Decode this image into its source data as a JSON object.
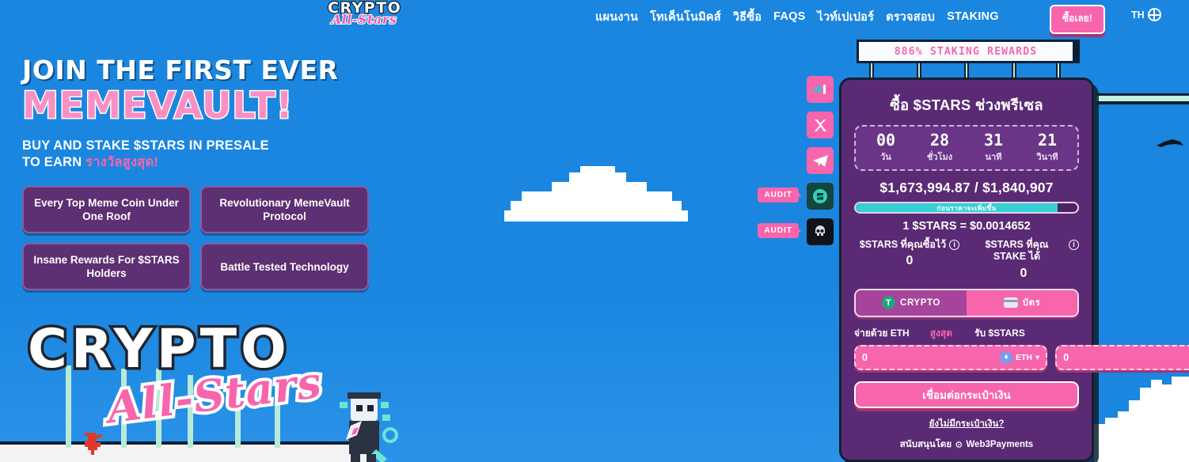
{
  "nav": {
    "logo_line1": "CRYPTO",
    "logo_line2": "All-Stars",
    "links": [
      {
        "label": "แผนงาน",
        "name": "roadmap"
      },
      {
        "label": "โทเค็นโนมิคส์",
        "name": "tokenomics"
      },
      {
        "label": "วิธีซื้อ",
        "name": "how-to-buy"
      },
      {
        "label": "FAQS",
        "name": "faqs"
      },
      {
        "label": "ไวท์เปเปอร์",
        "name": "whitepaper"
      },
      {
        "label": "ตรวจสอบ",
        "name": "audit"
      },
      {
        "label": "STAKING",
        "name": "staking"
      }
    ],
    "buy_label": "ซื้อเลย!",
    "lang_label": "TH",
    "lang_icon": "globe-icon"
  },
  "hero": {
    "line1": "JOIN THE FIRST EVER",
    "line2": "MEMEVAULT!",
    "sub_line1": "BUY AND STAKE $STARS IN PRESALE",
    "sub_line2_prefix": "TO EARN ",
    "sub_line2_highlight": "รางวัลสูงสุด!",
    "features": [
      "Every Top Meme Coin Under One Roof",
      "Revolutionary MemeVault Protocol",
      "Insane Rewards For $STARS Holders",
      "Battle Tested Technology"
    ]
  },
  "brand_logo": {
    "line1": "CRYPTO",
    "line2": "All-Stars"
  },
  "social": [
    {
      "name": "sound-icon",
      "glyph": "◀",
      "style": "pink",
      "audit": null
    },
    {
      "name": "x-twitter-icon",
      "glyph": "✕",
      "style": "pink",
      "audit": null
    },
    {
      "name": "telegram-icon",
      "glyph": "➤",
      "style": "pink",
      "audit": null
    },
    {
      "name": "coinsult-audit-icon",
      "glyph": "3",
      "style": "teal",
      "audit": "AUDIT"
    },
    {
      "name": "solidproof-audit-icon",
      "glyph": "☠",
      "style": "dark",
      "audit": "AUDIT"
    }
  ],
  "widget": {
    "banner": "886% STAKING REWARDS",
    "title": "ซื้อ $STARS ช่วงพรีเซล",
    "countdown": [
      {
        "value": "00",
        "label": "วัน"
      },
      {
        "value": "28",
        "label": "ชั่วโมง"
      },
      {
        "value": "31",
        "label": "นาที"
      },
      {
        "value": "21",
        "label": "วินาที"
      }
    ],
    "raised": "$1,673,994.87 / $1,840,907",
    "progress_text": "ก่อนราคาจะเพิ่มขึ้น",
    "progress_percent": 91,
    "rate": "1 $STARS = $0.0014652",
    "balance_bought_label": "$STARS ที่คุณซื้อไว้",
    "balance_bought_value": "0",
    "balance_staked_label": "$STARS ที่คุณ STAKE ได้",
    "balance_staked_value": "0",
    "pay_crypto_label": "CRYPTO",
    "pay_card_label": "บัตร",
    "pay_with_label": "จ่ายด้วย ETH",
    "max_label": "สูงสุด",
    "receive_label": "รับ $STARS",
    "pay_input_value": "0",
    "pay_token": "ETH",
    "receive_input_value": "0",
    "connect_label": "เชื่อมต่อกระเป๋าเงิน",
    "no_wallet_label": "ยังไม่มีกระเป๋าเงิน?",
    "powered_label": "สนับสนุนโดย",
    "powered_brand": "Web3Payments"
  },
  "colors": {
    "sky": "#1a86e0",
    "pink": "#f765ad",
    "purple": "#5b2a75",
    "teal": "#35cfd4",
    "dark": "#14202e"
  }
}
